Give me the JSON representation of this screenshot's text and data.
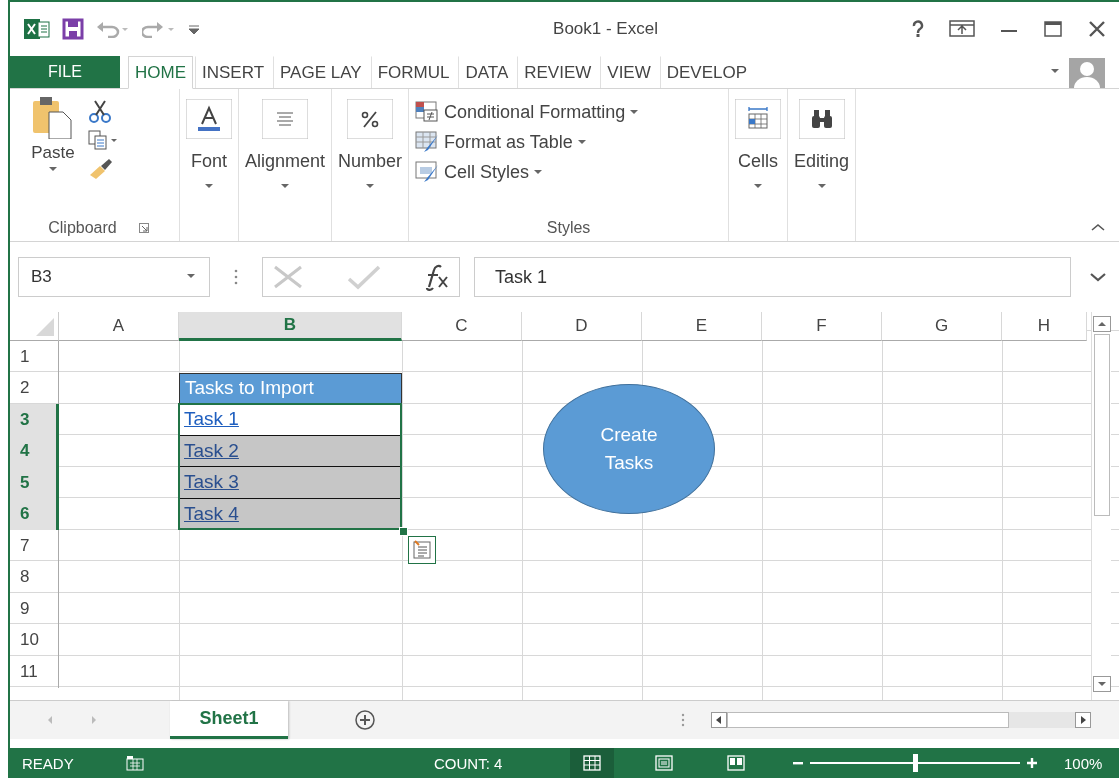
{
  "window": {
    "title": "Book1 - Excel"
  },
  "ribbon_tabs": [
    {
      "label": "FILE",
      "kind": "file",
      "selected": false
    },
    {
      "label": "HOME",
      "kind": "tab",
      "selected": true
    },
    {
      "label": "INSERT",
      "kind": "tab",
      "selected": false
    },
    {
      "label": "PAGE LAY",
      "kind": "tab",
      "selected": false
    },
    {
      "label": "FORMUL",
      "kind": "tab",
      "selected": false
    },
    {
      "label": "DATA",
      "kind": "tab",
      "selected": false
    },
    {
      "label": "REVIEW",
      "kind": "tab",
      "selected": false
    },
    {
      "label": "VIEW",
      "kind": "tab",
      "selected": false
    },
    {
      "label": "DEVELOP",
      "kind": "tab",
      "selected": false
    }
  ],
  "ribbon_groups": [
    {
      "kind": "clipboard",
      "button": "Paste",
      "label": "Clipboard"
    },
    {
      "kind": "collapsed",
      "label": "Font"
    },
    {
      "kind": "collapsed",
      "label": "Alignment"
    },
    {
      "kind": "collapsed",
      "label": "Number"
    },
    {
      "kind": "styles",
      "label": "Styles",
      "items": [
        {
          "label": "Conditional Formatting"
        },
        {
          "label": "Format as Table"
        },
        {
          "label": "Cell Styles"
        }
      ]
    },
    {
      "kind": "collapsed",
      "label": "Cells"
    },
    {
      "kind": "collapsed",
      "label": "Editing"
    }
  ],
  "formula_bar": {
    "name_box": "B3",
    "formula": "Task 1"
  },
  "columns": [
    {
      "label": "A",
      "selected": false
    },
    {
      "label": "B",
      "selected": true
    },
    {
      "label": "C",
      "selected": false
    },
    {
      "label": "D",
      "selected": false
    },
    {
      "label": "E",
      "selected": false
    },
    {
      "label": "F",
      "selected": false
    },
    {
      "label": "G",
      "selected": false
    },
    {
      "label": "H",
      "selected": false
    }
  ],
  "rows": [
    {
      "label": "1",
      "selected": false
    },
    {
      "label": "2",
      "selected": false,
      "b_cell": {
        "text": "Tasks to Import",
        "kind": "header"
      }
    },
    {
      "label": "3",
      "selected": true,
      "b_cell": {
        "text": "Task 1",
        "kind": "link",
        "active": true
      }
    },
    {
      "label": "4",
      "selected": true,
      "b_cell": {
        "text": "Task 2",
        "kind": "link",
        "active": false
      }
    },
    {
      "label": "5",
      "selected": true,
      "b_cell": {
        "text": "Task 3",
        "kind": "link",
        "active": false
      }
    },
    {
      "label": "6",
      "selected": true,
      "b_cell": {
        "text": "Task 4",
        "kind": "link",
        "active": false
      }
    },
    {
      "label": "7",
      "selected": false
    },
    {
      "label": "8",
      "selected": false
    },
    {
      "label": "9",
      "selected": false
    },
    {
      "label": "10",
      "selected": false
    },
    {
      "label": "11",
      "selected": false
    }
  ],
  "shape": {
    "text": "Create Tasks"
  },
  "sheet_tabs": [
    {
      "label": "Sheet1",
      "selected": true
    }
  ],
  "status_bar": {
    "mode": "READY",
    "summary": "COUNT: 4",
    "views": [
      {
        "kind": "normal",
        "selected": true
      },
      {
        "kind": "page_layout",
        "selected": false
      },
      {
        "kind": "page_break",
        "selected": false
      }
    ],
    "zoom": {
      "level": 0.5,
      "reading": "100%"
    }
  }
}
